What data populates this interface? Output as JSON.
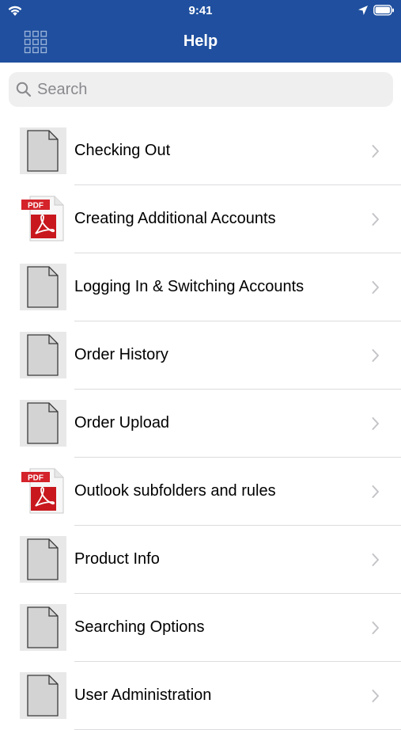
{
  "status": {
    "time": "9:41"
  },
  "nav": {
    "title": "Help"
  },
  "search": {
    "placeholder": "Search"
  },
  "items": [
    {
      "label": "Checking Out",
      "icon": "document-icon"
    },
    {
      "label": "Creating Additional Accounts",
      "icon": "pdf-icon"
    },
    {
      "label": "Logging In & Switching Accounts",
      "icon": "document-icon"
    },
    {
      "label": "Order History",
      "icon": "document-icon"
    },
    {
      "label": "Order Upload",
      "icon": "document-icon"
    },
    {
      "label": "Outlook subfolders and rules",
      "icon": "pdf-icon"
    },
    {
      "label": "Product Info",
      "icon": "document-icon"
    },
    {
      "label": "Searching Options",
      "icon": "document-icon"
    },
    {
      "label": "User Administration",
      "icon": "document-icon"
    }
  ],
  "pdf_badge": "PDF",
  "colors": {
    "header": "#1f4f9e",
    "pdf_red": "#d4232a"
  }
}
